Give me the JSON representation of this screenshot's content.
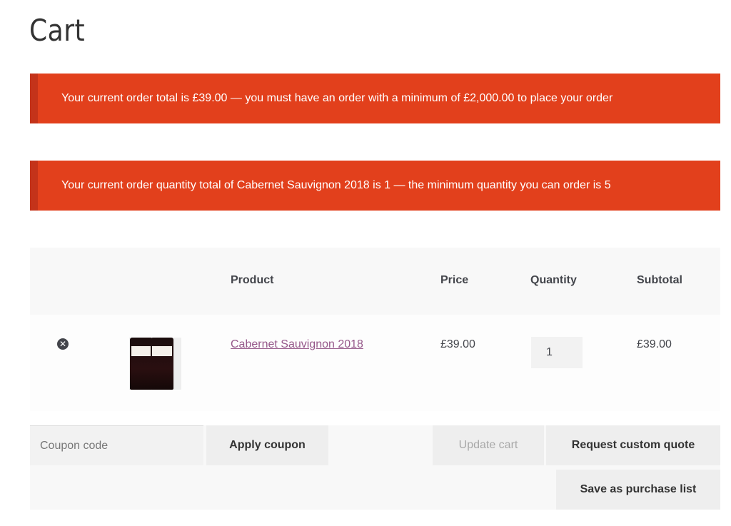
{
  "page": {
    "title": "Cart"
  },
  "notices": [
    "Your current order total is £39.00 — you must have an order with a minimum of £2,000.00 to place your order",
    "Your current order quantity total of Cabernet Sauvignon 2018 is 1 — the minimum quantity you can order is 5"
  ],
  "table": {
    "headers": {
      "product": "Product",
      "price": "Price",
      "quantity": "Quantity",
      "subtotal": "Subtotal"
    },
    "rows": [
      {
        "product": "Cabernet Sauvignon 2018",
        "price": "£39.00",
        "quantity": "1",
        "subtotal": "£39.00",
        "remove_icon": "remove-circle-icon"
      }
    ]
  },
  "actions": {
    "coupon_placeholder": "Coupon code",
    "apply_coupon": "Apply coupon",
    "update_cart": "Update cart",
    "request_quote": "Request custom quote",
    "save_list": "Save as purchase list"
  },
  "colors": {
    "notice": "#e2401c",
    "link": "#96588a"
  }
}
